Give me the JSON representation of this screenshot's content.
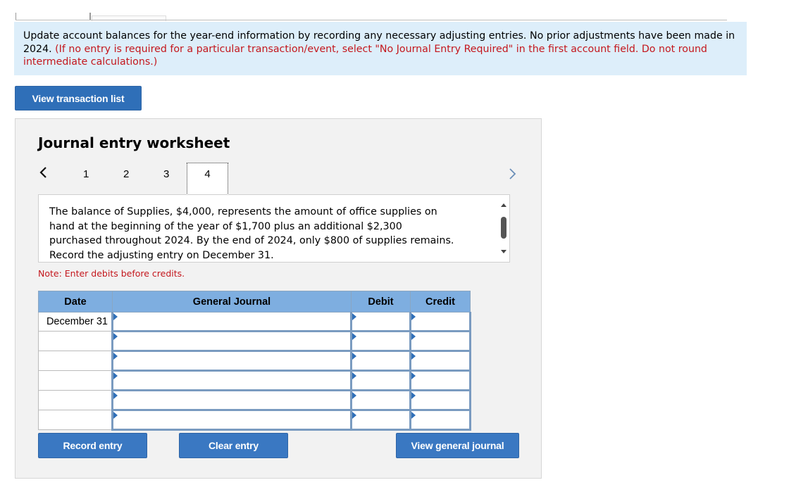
{
  "instructions": {
    "main": "Update account balances for the year-end information by recording any necessary adjusting entries. No prior adjustments have been made in 2024.",
    "hint": "(If no entry is required for a particular transaction/event, select \"No Journal Entry Required\" in the first account field. Do not round intermediate calculations.)"
  },
  "buttons": {
    "view_transaction_list": "View transaction list",
    "record_entry": "Record entry",
    "clear_entry": "Clear entry",
    "view_general_journal": "View general journal"
  },
  "worksheet": {
    "title": "Journal entry worksheet",
    "pages": [
      "1",
      "2",
      "3",
      "4"
    ],
    "current_page": "4",
    "description": "The balance of Supplies, $4,000, represents the amount of office supplies on hand at the beginning of the year of $1,700 plus an additional $2,300 purchased throughout 2024. By the end of 2024, only $800 of supplies remains. Record the adjusting entry on December 31.",
    "note": "Note: Enter debits before credits."
  },
  "journal": {
    "headers": {
      "date": "Date",
      "account": "General Journal",
      "debit": "Debit",
      "credit": "Credit"
    },
    "first_date": "December 31"
  },
  "icons": {
    "prev": "chevron-left-icon",
    "next": "chevron-right-icon"
  },
  "colors": {
    "instruction_bg": "#ddeefa",
    "hint_red": "#c4171d",
    "button_blue": "#3a78c2",
    "header_blue": "#7eaee0"
  }
}
